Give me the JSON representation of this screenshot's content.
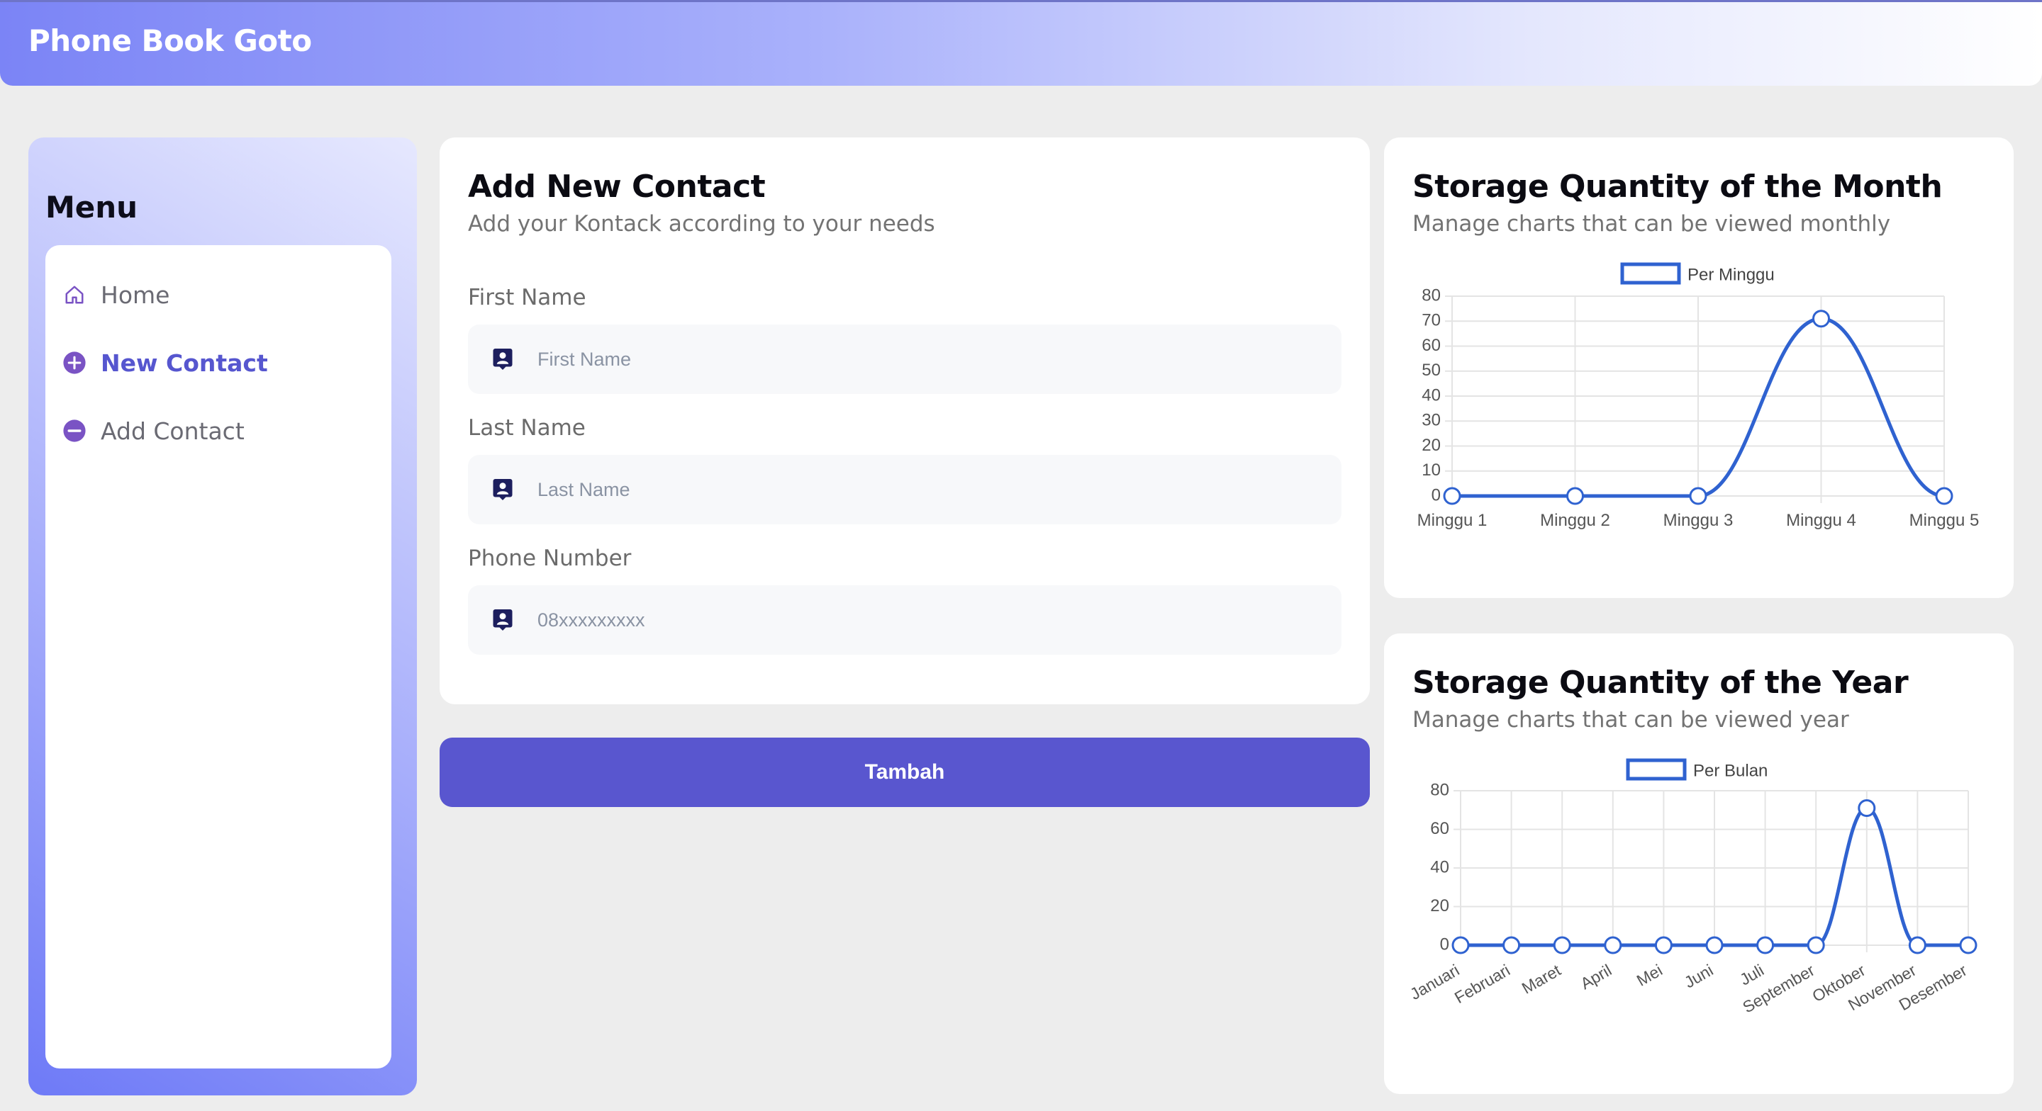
{
  "app": {
    "title": "Phone Book Goto"
  },
  "sidebar": {
    "title": "Menu",
    "items": [
      {
        "label": "Home",
        "icon": "home-icon",
        "active": false
      },
      {
        "label": "New Contact",
        "icon": "plus-circle-icon",
        "active": true
      },
      {
        "label": "Add Contact",
        "icon": "minus-circle-icon",
        "active": false
      }
    ]
  },
  "form": {
    "title": "Add New Contact",
    "subtitle": "Add your Kontack according to your needs",
    "fields": [
      {
        "label": "First Name",
        "placeholder": "First Name",
        "value": "",
        "icon": "contact-card-icon"
      },
      {
        "label": "Last Name",
        "placeholder": "Last Name",
        "value": "",
        "icon": "contact-card-icon"
      },
      {
        "label": "Phone Number",
        "placeholder": "08xxxxxxxxx",
        "value": "",
        "icon": "contact-card-icon"
      }
    ],
    "submit_label": "Tambah"
  },
  "colors": {
    "accent": "#5956cf",
    "active_menu": "#5656cf",
    "chart_line": "#2f62d0",
    "icon_dark": "#1d1f5e",
    "menu_icon": "#7a53c4"
  },
  "charts": {
    "month": {
      "title": "Storage Quantity of the Month",
      "subtitle": "Manage charts that can be viewed monthly"
    },
    "year": {
      "title": "Storage Quantity of the Year",
      "subtitle": "Manage charts that can be viewed year"
    }
  },
  "chart_data": [
    {
      "type": "line",
      "title": "",
      "categories": [
        "Minggu 1",
        "Minggu 2",
        "Minggu 3",
        "Minggu 4",
        "Minggu 5"
      ],
      "series": [
        {
          "name": "Per Minggu",
          "values": [
            0,
            0,
            0,
            71,
            0
          ]
        }
      ],
      "ylim": [
        0,
        80
      ],
      "yticks": [
        0,
        10,
        20,
        30,
        40,
        50,
        60,
        70,
        80
      ],
      "grid": true,
      "legend": "top-center"
    },
    {
      "type": "line",
      "title": "",
      "categories": [
        "Januari",
        "Februari",
        "Maret",
        "April",
        "Mei",
        "Juni",
        "Juli",
        "September",
        "Oktober",
        "November",
        "Desember"
      ],
      "series": [
        {
          "name": "Per Bulan",
          "values": [
            0,
            0,
            0,
            0,
            0,
            0,
            0,
            0,
            71,
            0,
            0
          ]
        }
      ],
      "ylim": [
        0,
        80
      ],
      "yticks": [
        0,
        20,
        40,
        60,
        80
      ],
      "grid": true,
      "legend": "top-center"
    }
  ]
}
